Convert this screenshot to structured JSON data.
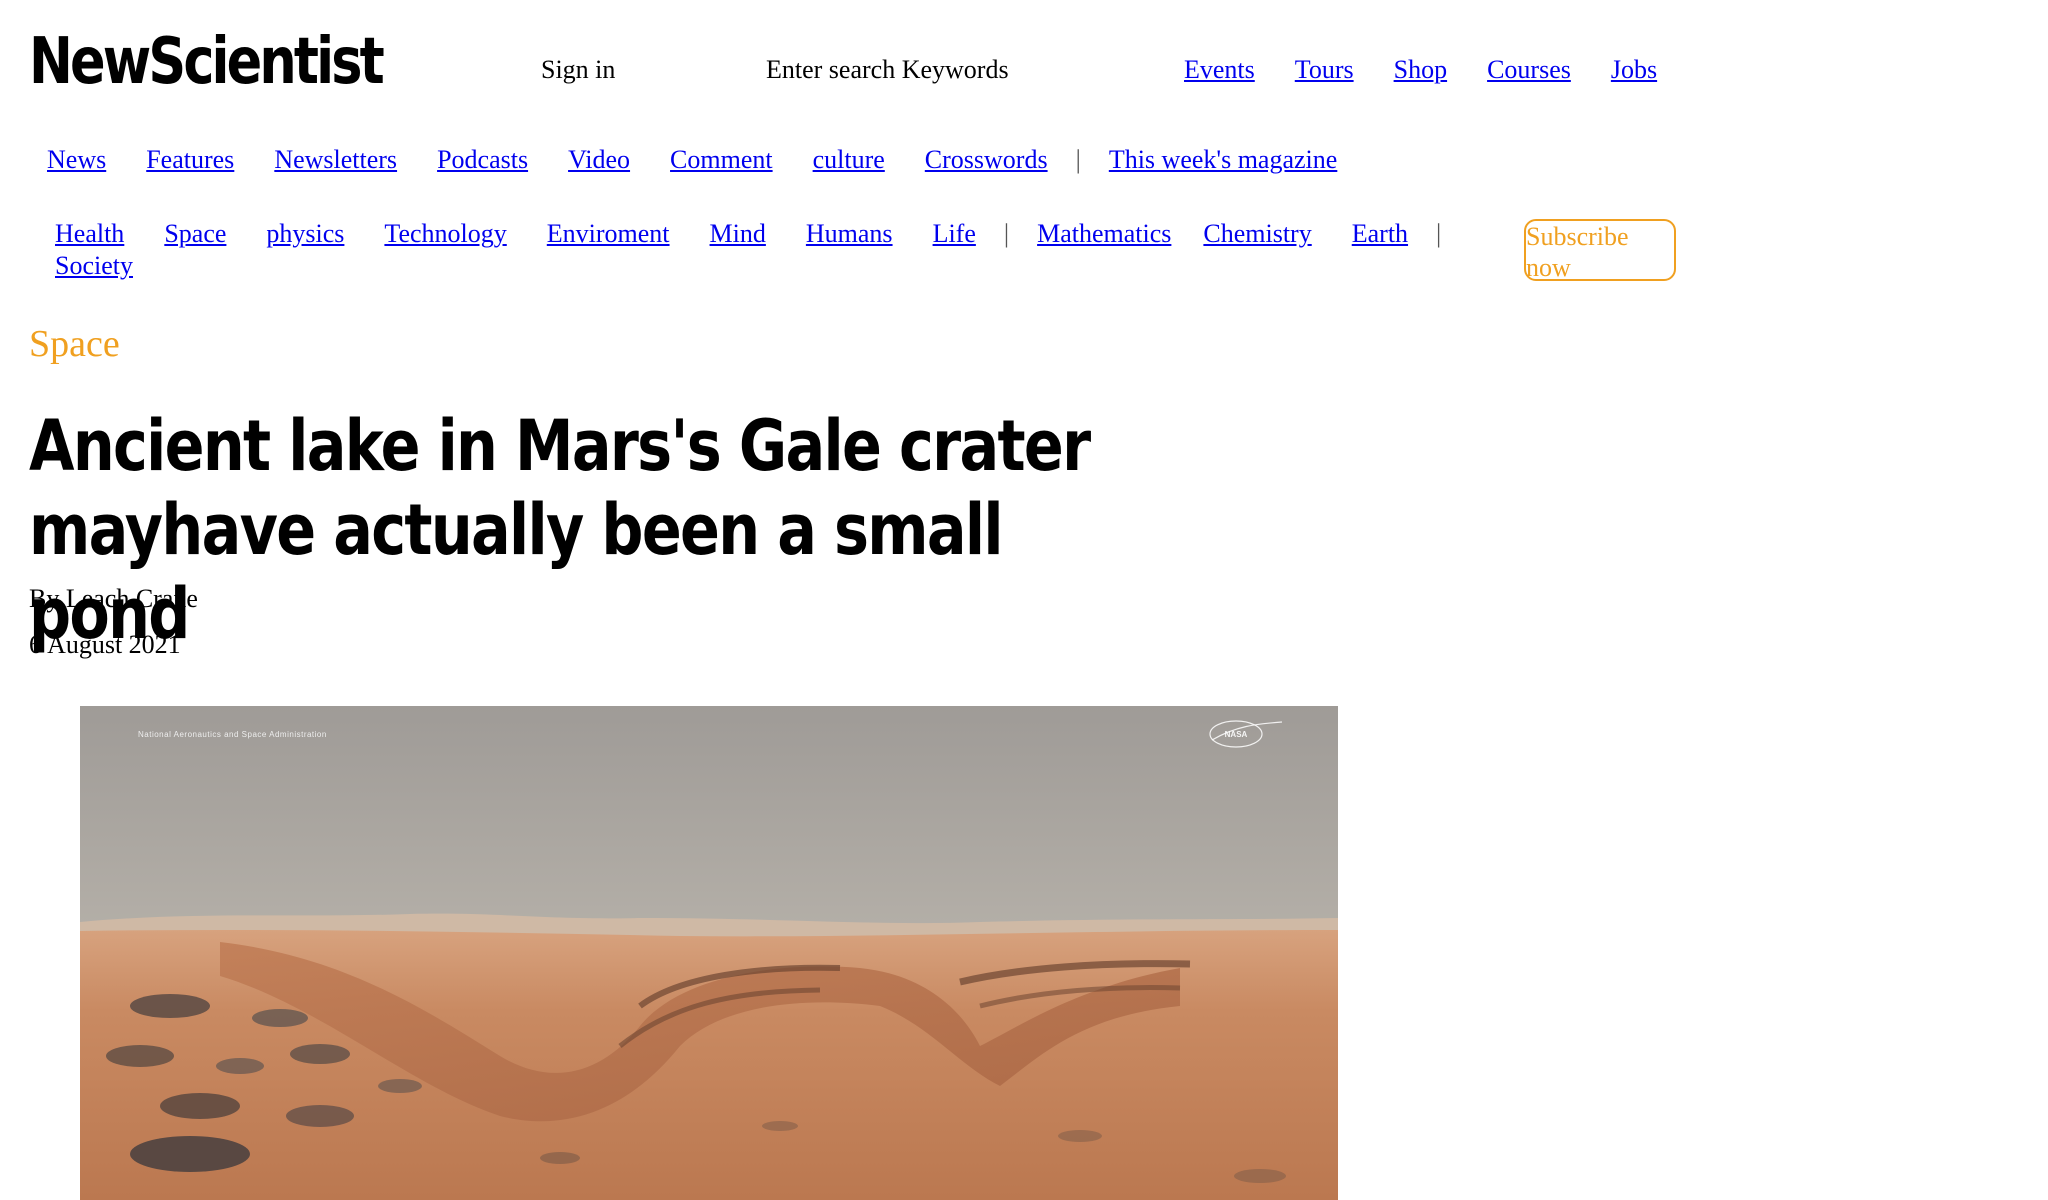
{
  "header": {
    "logo": "NewScientist",
    "sign_in": "Sign in",
    "search_placeholder": "Enter search Keywords",
    "top_links": [
      "Events",
      "Tours",
      "Shop",
      "Courses",
      "Jobs"
    ]
  },
  "nav": {
    "items": [
      "News",
      "Features",
      "Newsletters",
      "Podcasts",
      "Video",
      "Comment",
      "culture",
      "Crosswords"
    ],
    "separator": "|",
    "magazine": "This week's magazine"
  },
  "sections": {
    "items": [
      "Health",
      "Space",
      "physics",
      "Technology",
      "Enviroment",
      "Mind",
      "Humans",
      "Life"
    ],
    "separator": "|",
    "items2": [
      "Mathematics ",
      "Chemistry",
      "Earth"
    ],
    "separator2": "|",
    "second_row": "Society",
    "subscribe": "Subscribe now"
  },
  "article": {
    "section": "Space",
    "headline": "Ancient lake in Mars's Gale crater mayhave actually been a small pond",
    "byline": "By Leach Crane",
    "date": "6 August 2021"
  },
  "hero_image": {
    "description_icon": "nasa-logo",
    "credit": "National Aeronautics and Space Administration",
    "logo_text": "NASA",
    "colors": {
      "sky_top": "#a09c98",
      "sky_horizon": "#d4ccc0",
      "ground": "#c8805a",
      "ground_dark": "#a0603e"
    }
  }
}
